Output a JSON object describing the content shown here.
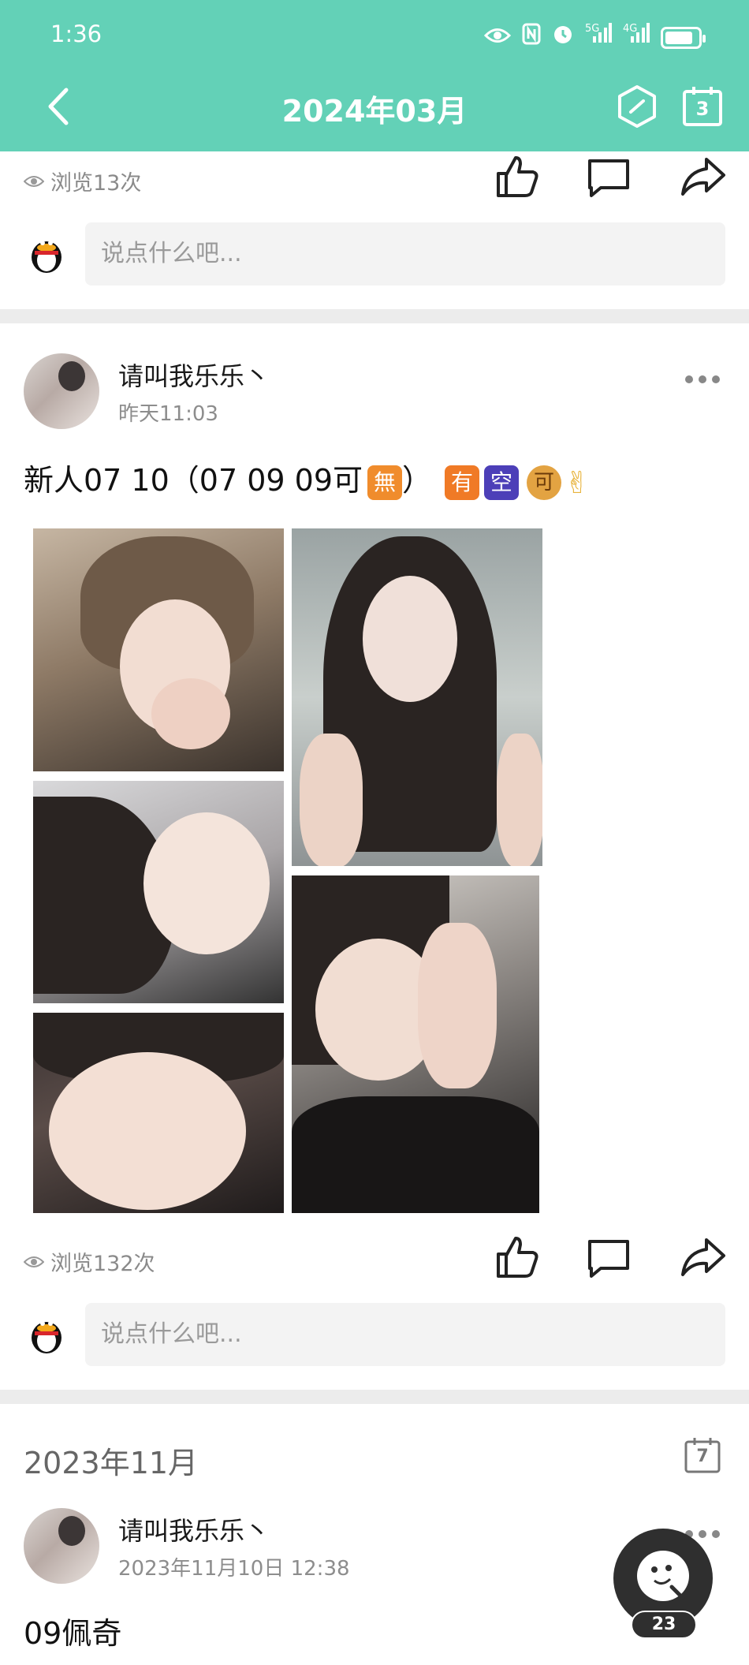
{
  "status_bar": {
    "time": "1:36",
    "network_1": "5G",
    "network_2": "4G"
  },
  "header": {
    "title": "2024年03月",
    "calendar_day": "3"
  },
  "post_prev": {
    "views": "浏览13次",
    "comment_placeholder": "说点什么吧..."
  },
  "post_main": {
    "user_name": "请叫我乐乐丶",
    "time": "昨天11:03",
    "text_prefix": "新人07  10（07  09  09可",
    "emoji_wu": "無",
    "text_close": "）",
    "emoji_you": "有",
    "emoji_kong": "空",
    "emoji_ke": "可",
    "emoji_victory": "✌",
    "views": "浏览132次",
    "comment_placeholder": "说点什么吧..."
  },
  "section": {
    "month": "2023年11月",
    "calendar_day": "7"
  },
  "post_next": {
    "user_name": "请叫我乐乐丶",
    "time": "2023年11月10日 12:38",
    "text": "09佩奇"
  },
  "fab": {
    "badge": "23"
  },
  "colors": {
    "header": "#63d1b7",
    "divider": "#ececec",
    "muted": "#8d8d8d"
  }
}
